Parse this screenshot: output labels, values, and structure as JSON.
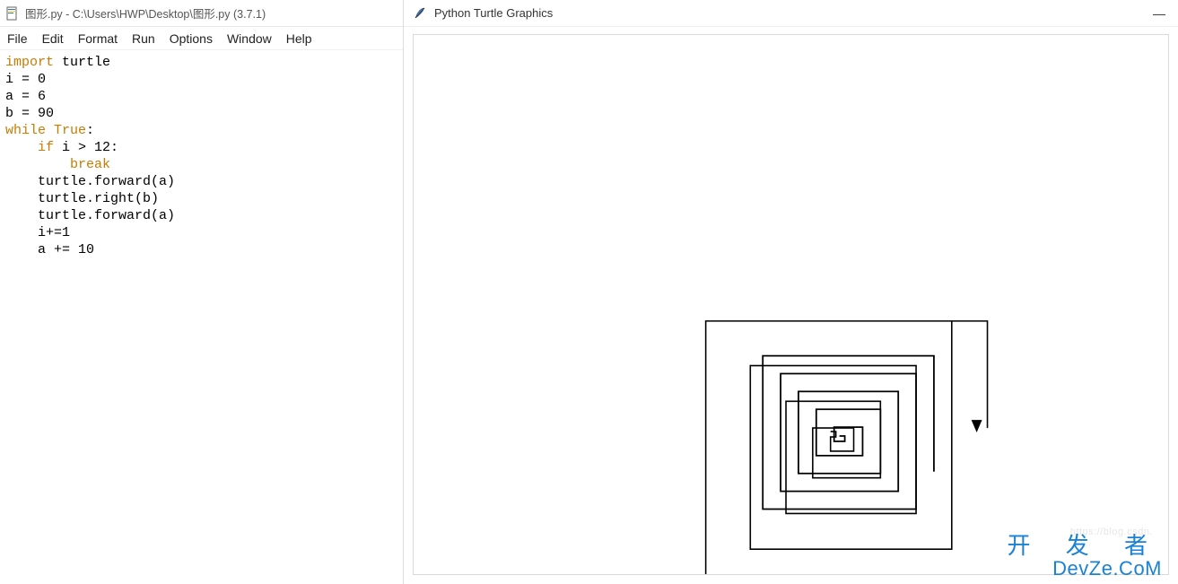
{
  "idle": {
    "titlebar": "图形.py - C:\\Users\\HWP\\Desktop\\图形.py (3.7.1)",
    "menu": {
      "file": "File",
      "edit": "Edit",
      "format": "Format",
      "run": "Run",
      "options": "Options",
      "window": "Window",
      "help": "Help"
    },
    "code": {
      "l1_kw": "import",
      "l1_rest": " turtle",
      "l2": "i = 0",
      "l3": "a = 6",
      "l4": "b = 90",
      "l5_kw": "while",
      "l5_mid": " ",
      "l5_kw2": "True",
      "l5_end": ":",
      "l6_indent": "    ",
      "l6_kw": "if",
      "l6_rest": " i > 12:",
      "l7_indent": "        ",
      "l7_kw": "break",
      "l8": "    turtle.forward(a)",
      "l9": "    turtle.right(b)",
      "l10": "    turtle.forward(a)",
      "l11": "    i+=1",
      "l12": "    a += 10"
    }
  },
  "turtle_win": {
    "title": "Python Turtle Graphics",
    "minimize": "—"
  },
  "watermark": {
    "url": "https://blog.csdn.",
    "brand_top": "开 发 者",
    "brand_bottom": "DevZe.CoM"
  }
}
